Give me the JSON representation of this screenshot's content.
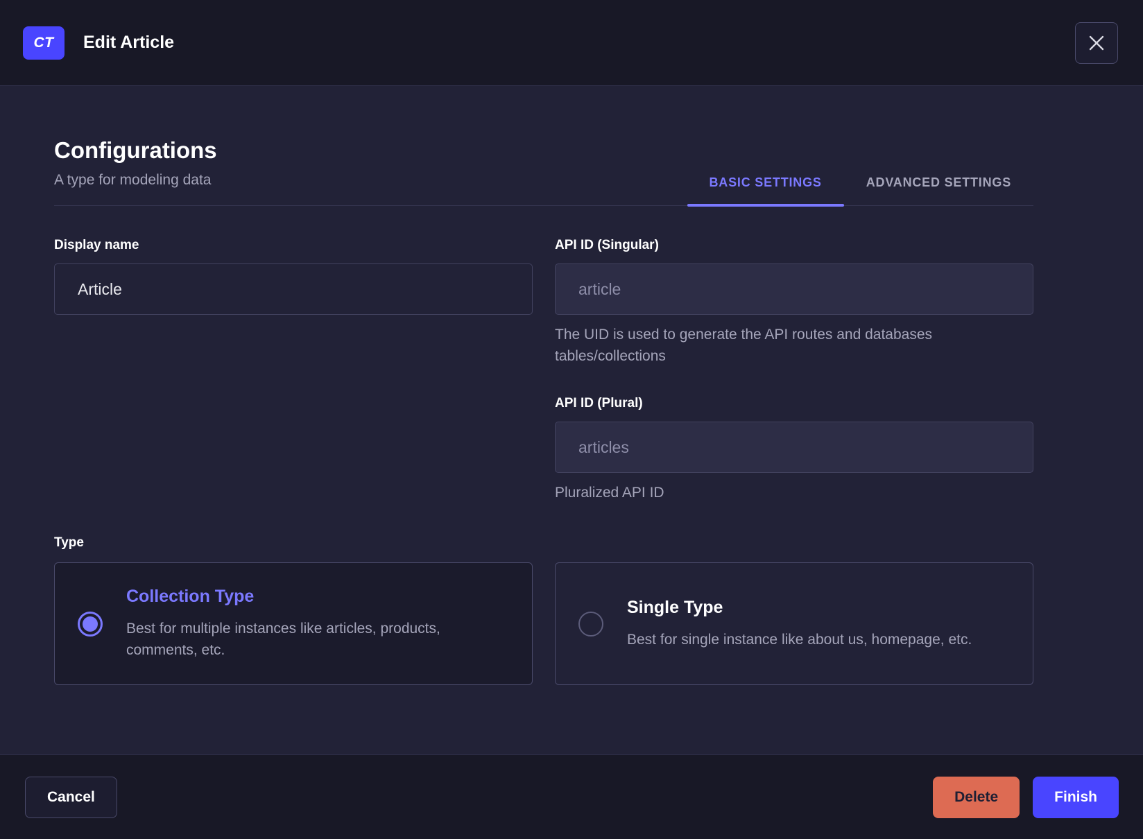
{
  "header": {
    "badge": "CT",
    "title": "Edit Article"
  },
  "page": {
    "title": "Configurations",
    "subtitle": "A type for modeling data"
  },
  "tabs": [
    {
      "label": "BASIC SETTINGS",
      "active": true
    },
    {
      "label": "ADVANCED SETTINGS",
      "active": false
    }
  ],
  "form": {
    "display_name": {
      "label": "Display name",
      "value": "Article"
    },
    "api_id_singular": {
      "label": "API ID (Singular)",
      "value": "article",
      "hint": "The UID is used to generate the API routes and databases tables/collections"
    },
    "api_id_plural": {
      "label": "API ID (Plural)",
      "value": "articles",
      "hint": "Pluralized API ID"
    },
    "type": {
      "label": "Type",
      "options": [
        {
          "title": "Collection Type",
          "description": "Best for multiple instances like articles, products, comments, etc.",
          "selected": true
        },
        {
          "title": "Single Type",
          "description": "Best for single instance like about us, homepage, etc.",
          "selected": false
        }
      ]
    }
  },
  "footer": {
    "cancel_label": "Cancel",
    "delete_label": "Delete",
    "finish_label": "Finish"
  },
  "colors": {
    "accent_light": "#7b79ff",
    "primary": "#4945ff",
    "danger": "#dd6b53",
    "header_bg": "#181826",
    "body_bg": "#222237"
  }
}
